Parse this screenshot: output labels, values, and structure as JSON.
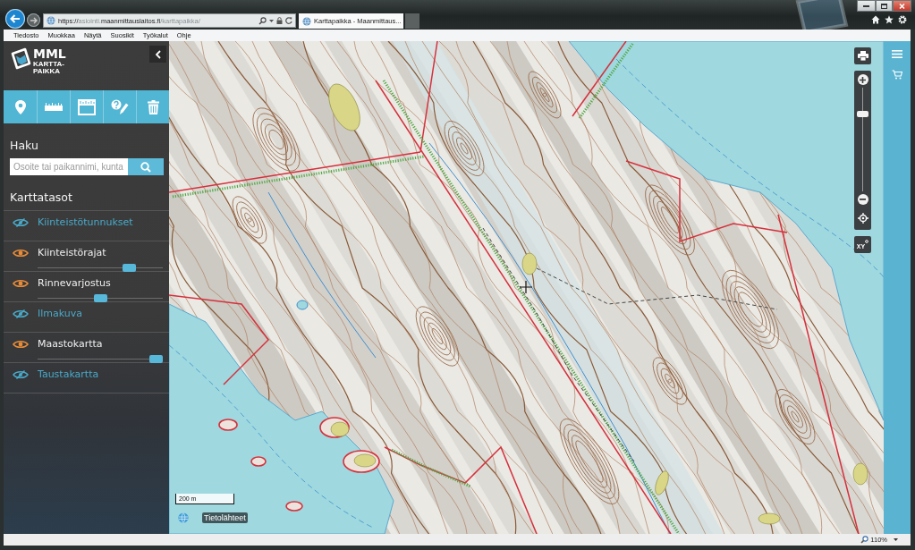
{
  "browser": {
    "url": {
      "scheme": "https://",
      "subdomain": "asiointi.",
      "domain": "maanmittauslaitos.fi",
      "path": "/karttapaikka/"
    },
    "tab": {
      "title": "Karttapaikka - Maanmittaus..."
    },
    "menu": [
      "Tiedosto",
      "Muokkaa",
      "Näytä",
      "Suosikit",
      "Työkalut",
      "Ohje"
    ]
  },
  "sidebar": {
    "logo": {
      "title": "MML",
      "subtitle_lines": [
        "KARTTA-",
        "PAIKKA"
      ]
    },
    "search": {
      "heading": "Haku",
      "placeholder": "Osoite tai paikannimi, kunta"
    },
    "layers_heading": "Karttatasot",
    "layers": [
      {
        "name": "Kiinteistötunnukset",
        "visible": false
      },
      {
        "name": "Kiinteistörajat",
        "visible": true,
        "level": 0.76
      },
      {
        "name": "Rinnevarjostus",
        "visible": true,
        "level": 0.5
      },
      {
        "name": "Ilmakuva",
        "visible": false
      },
      {
        "name": "Maastokartta",
        "visible": true,
        "level": 1
      },
      {
        "name": "Taustakartta",
        "visible": false
      }
    ]
  },
  "map": {
    "scale": "200 m",
    "attribution": "Tietolähteet",
    "zoom_control": {
      "level": 0.76
    },
    "coordinates_button": "XY"
  },
  "status_bar": {
    "zoom": "110%"
  }
}
